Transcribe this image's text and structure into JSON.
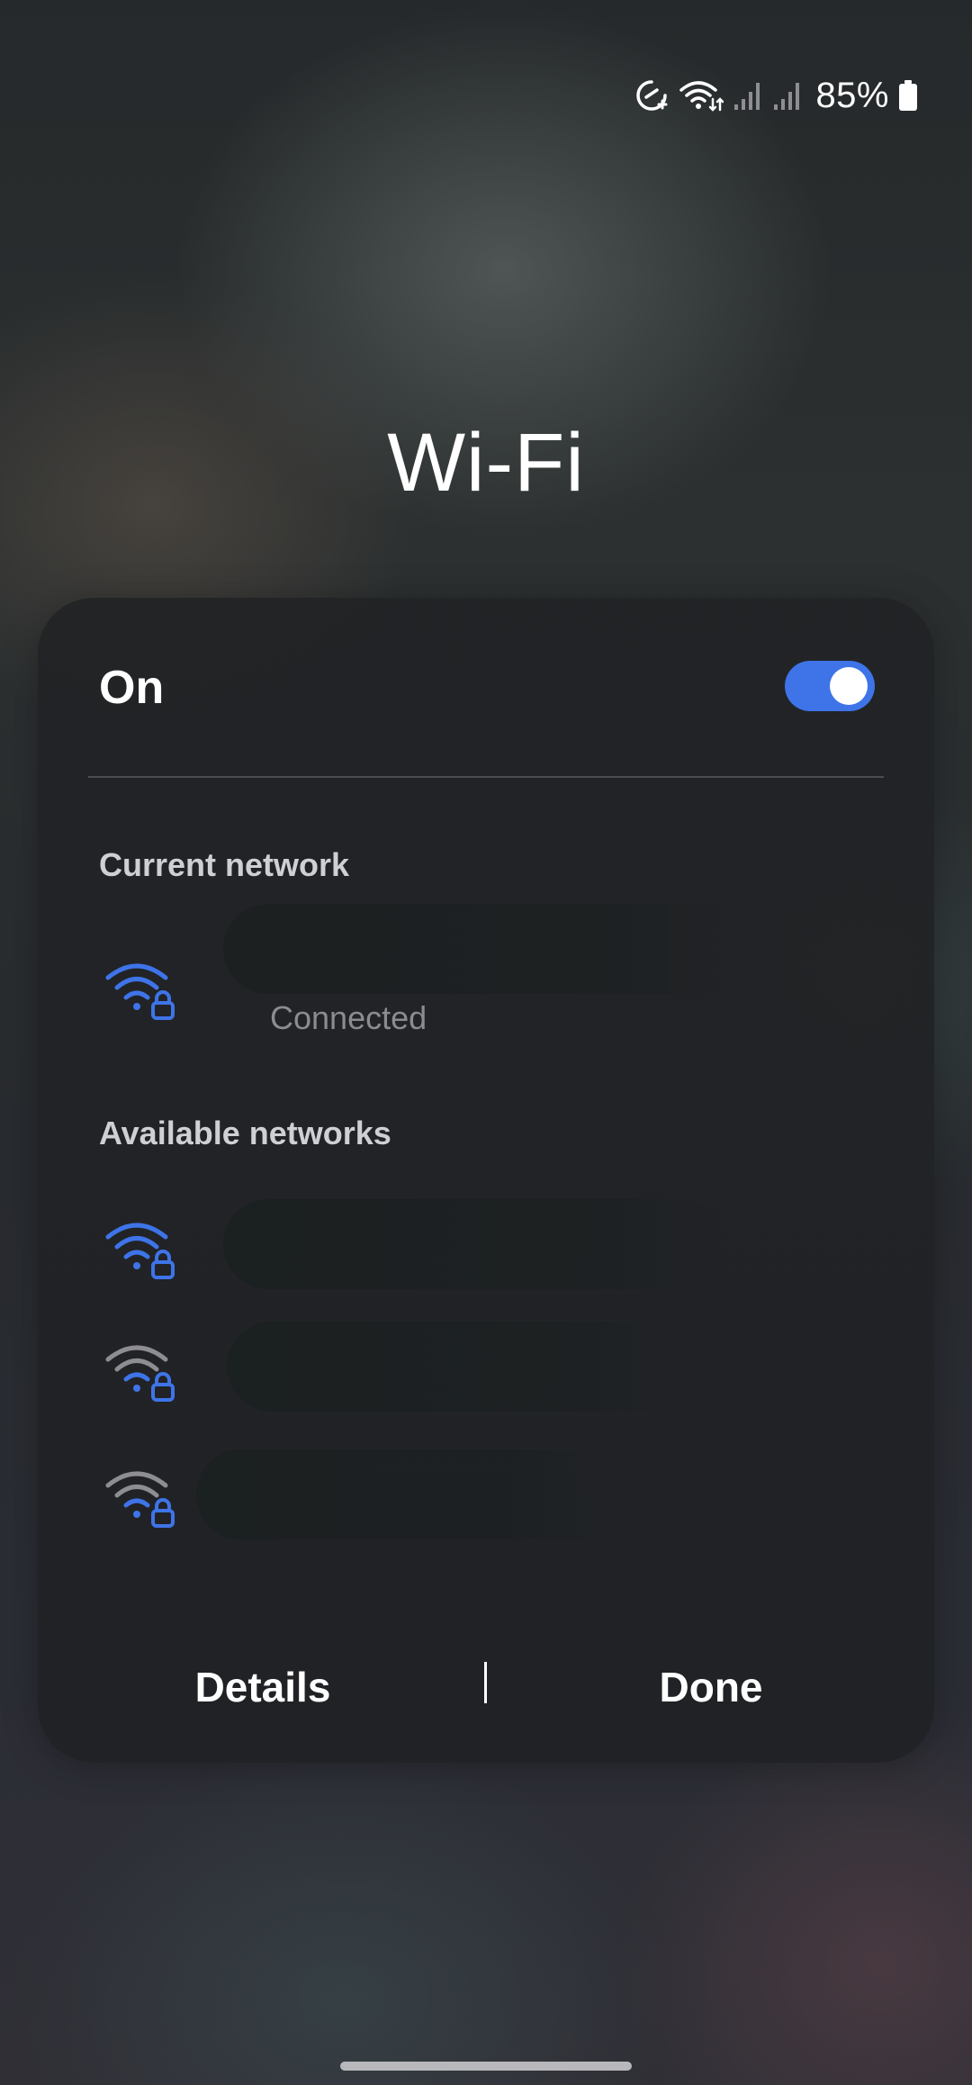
{
  "status_bar": {
    "battery_percent": "85%",
    "icons": [
      "data-saver-icon",
      "wifi-activity-icon",
      "signal-icon-sim1",
      "signal-icon-sim2",
      "battery-icon"
    ]
  },
  "title": "Wi-Fi",
  "toggle": {
    "label": "On",
    "state": true,
    "accent_color": "#3e74e8"
  },
  "current_network": {
    "header": "Current network",
    "network": {
      "name": "",
      "status": "Connected",
      "icon": "wifi-secure-icon",
      "signal_color": "#3e74e8"
    }
  },
  "available_networks": {
    "header": "Available networks",
    "networks": [
      {
        "name": "",
        "icon": "wifi-secure-icon",
        "signal": "full",
        "signal_color": "#3e74e8"
      },
      {
        "name": "",
        "icon": "wifi-secure-icon",
        "signal": "weak",
        "signal_color": "#8e8e92"
      },
      {
        "name": "",
        "icon": "wifi-secure-icon",
        "signal": "weak",
        "signal_color": "#8e8e92"
      }
    ]
  },
  "footer": {
    "details_label": "Details",
    "done_label": "Done"
  }
}
